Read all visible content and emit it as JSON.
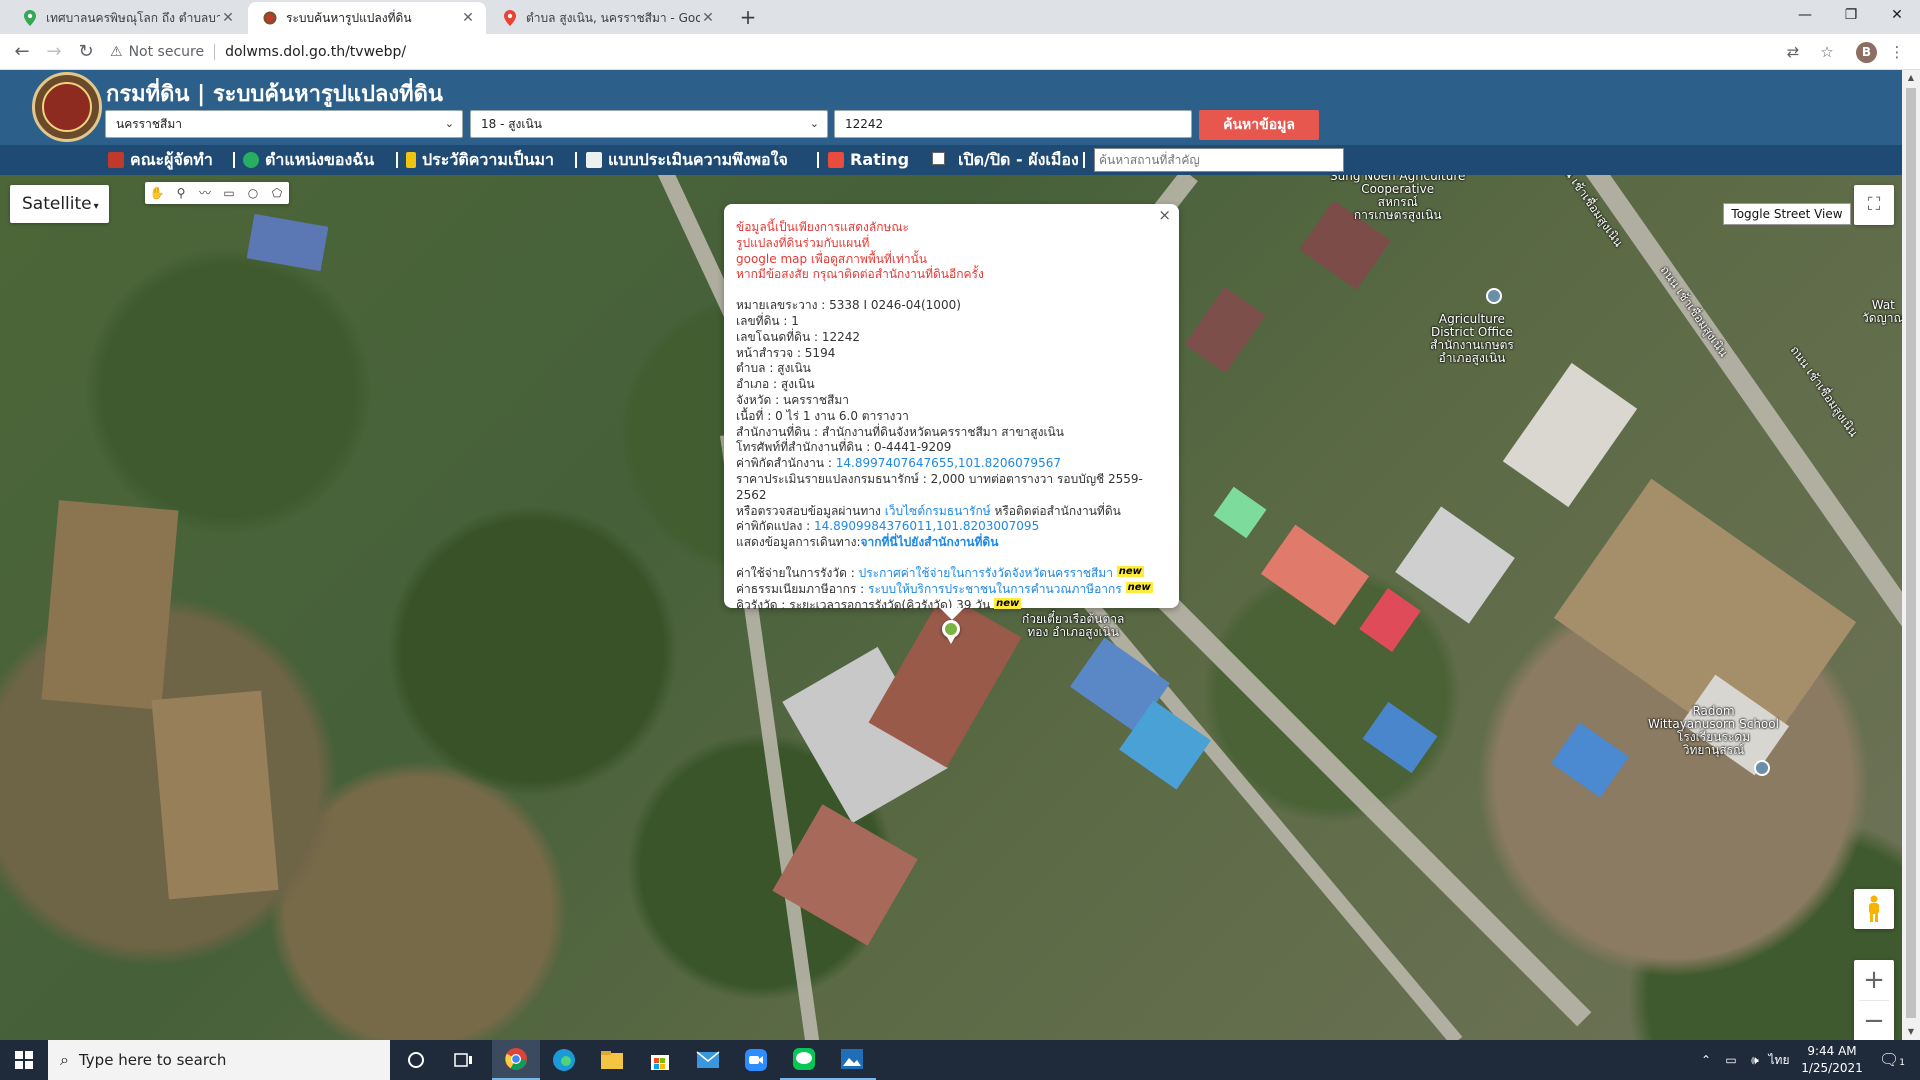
{
  "browser": {
    "tabs": [
      {
        "title": "เทศบาลนครพิษณุโลก ถึง ตำบลบางระกำ",
        "icon": "maps-pin-icon",
        "active": false
      },
      {
        "title": "ระบบค้นหารูปแปลงที่ดิน",
        "icon": "dol-seal-icon",
        "active": true
      },
      {
        "title": "ตำบล สูงเนิน, นครราชสีมา - Google",
        "icon": "maps-pin-icon",
        "active": false
      }
    ],
    "new_tab_label": "+",
    "security_label": "Not secure",
    "url": "dolwms.dol.go.th/tvwebp/",
    "profile_initial": "B"
  },
  "site": {
    "title": "กรมที่ดิน | ระบบค้นหารูปแปลงที่ดิน",
    "province_select": "นครราชสีมา",
    "office_select": "18 - สูงเนิน",
    "deed_number_value": "12242",
    "search_button": "ค้นหาข้อมูล",
    "nav": [
      {
        "label": "คณะผู้จัดทำ",
        "icon": "team-icon",
        "color": "#c0392b"
      },
      {
        "label": "ตำแหน่งของฉัน",
        "icon": "globe-icon",
        "color": "#27ae60"
      },
      {
        "label": "ประวัติความเป็นมา",
        "icon": "sprout-icon",
        "color": "#f1c40f"
      },
      {
        "label": "แบบประเมินความพึงพอใจ",
        "icon": "survey-icon",
        "color": "#ecf0f1"
      },
      {
        "label": "Rating",
        "icon": "chart-icon",
        "color": "#e74c3c"
      },
      {
        "label": "เปิด/ปิด - ผังเมือง",
        "icon": "checkbox-icon",
        "color": "#ffffff"
      }
    ],
    "place_search_placeholder": "ค้นหาสถานที่สำคัญ"
  },
  "map": {
    "map_type": "Satellite",
    "toggle_street_view": "Toggle Street View",
    "zoom_in": "+",
    "zoom_out": "−",
    "labels": {
      "coop": "Sung Noen Agriculture\nCooperative\nสหกรณ์\nการเกษตรสูงเนิน",
      "district_office": "Agriculture\nDistrict Office\nสำนักงานเกษตร\nอำเภอสูงเนิน",
      "school": "Radom\nWittayanusorn School\nโรงเรียนระดม\nวิทยานุสรณ์",
      "noodle": "ก๋วยเตี๋ยวเรือต้นตาล\nทอง อำเภอสูงเนิน",
      "road1": "ถนน เช้าเชื่อมสูงเนิน",
      "road2": "ถนน เช้าเชื่อมสูงเนิน",
      "road3": "ถนน เช้าเชื่อมสูงเนิน",
      "wat": "Wat\nวัดญาณ"
    }
  },
  "infowindow": {
    "disclaimer": [
      "ข้อมูลนี้เป็นเพียงการแสดงลักษณะ",
      "รูปแปลงที่ดินร่วมกับแผนที่",
      "google map เพื่อดูสภาพพื้นที่เท่านั้น",
      "หากมีข้อสงสัย กรุณาติดต่อสำนักงานที่ดินอีกครั้ง"
    ],
    "survey_sheet": "หมายเลขระวาง : 5338 I 0246-04(1000)",
    "parcel_no": "เลขที่ดิน : 1",
    "deed_no": "เลขโฉนดที่ดิน : 12242",
    "survey_page": "หน้าสำรวจ : 5194",
    "subdistrict": "ตำบล : สูงเนิน",
    "district": "อำเภอ : สูงเนิน",
    "province": "จังหวัด : นครราชสีมา",
    "area": "เนื้อที่ : 0 ไร่ 1 งาน 6.0 ตารางวา",
    "land_office": "สำนักงานที่ดิน : สำนักงานที่ดินจังหวัดนครราชสีมา สาขาสูงเนิน",
    "office_phone": "โทรศัพท์ที่สำนักงานที่ดิน : 0-4441-9209",
    "office_coords_label": "ค่าพิกัดสำนักงาน : ",
    "office_coords_value": "14.8997407647655,101.8206079567",
    "appraisal_text": "ราคาประเมินรายแปลงกรมธนารักษ์ : 2,000 บาทต่อตารางวา รอบบัญชี 2559-2562",
    "appraisal_check_prefix": "หรือตรวจสอบข้อมูลผ่านทาง ",
    "appraisal_check_link": "เว็บไซต์กรมธนารักษ์",
    "appraisal_check_suffix": " หรือติดต่อสำนักงานที่ดิน",
    "parcel_coords_label": "ค่าพิกัดแปลง : ",
    "parcel_coords_value": "14.8909984376011,101.8203007095",
    "route_prefix": "แสดงข้อมูลการเดินทาง:",
    "route_link": "จากที่นี่ไปยังสำนักงานที่ดิน",
    "fee_label": "ค่าใช้จ่ายในการรังวัด : ",
    "fee_link": "ประกาศค่าใช้จ่ายในการรังวัดจังหวัดนครราชสีมา",
    "tax_label": "ค่าธรรมเนียมภาษีอากร : ",
    "tax_link": "ระบบให้บริการประชาชนในการคำนวณภาษีอากร",
    "queue_label": "คิวรังวัด : ระยะเวลารอการรังวัด(คิวรังวัด) 39 วัน",
    "new_badge": "new",
    "close": "×"
  },
  "taskbar": {
    "search_placeholder": "Type here to search",
    "language": "ไทย",
    "time": "9:44 AM",
    "date": "1/25/2021",
    "notification_count": "1",
    "apps": [
      "task-view-icon",
      "chrome-icon",
      "edge-icon",
      "file-explorer-icon",
      "store-icon",
      "mail-icon",
      "zoom-icon",
      "line-icon",
      "photos-icon"
    ]
  }
}
